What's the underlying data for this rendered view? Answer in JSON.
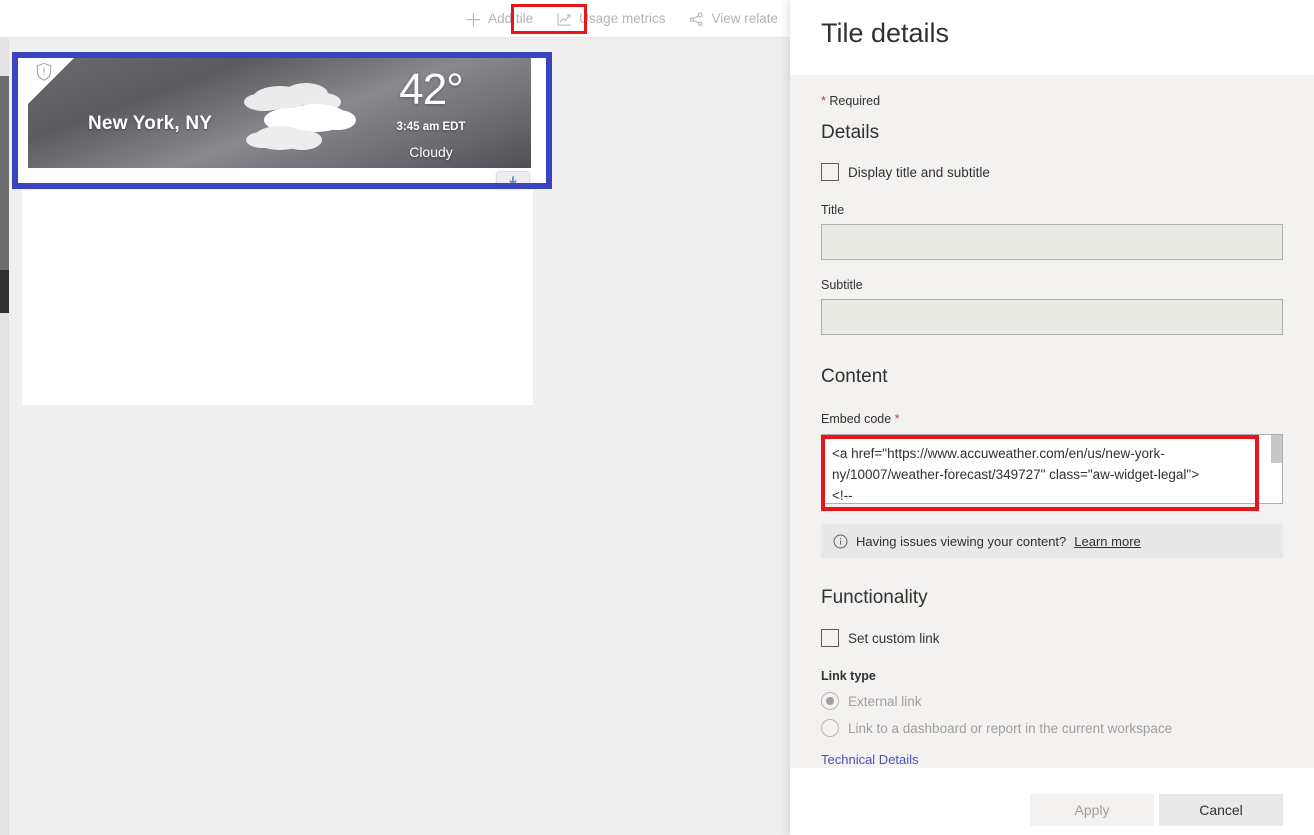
{
  "toolbar": {
    "items": [
      {
        "label": "Add tile",
        "icon": "plus-icon"
      },
      {
        "label": "Usage metrics",
        "icon": "usage-metrics-icon"
      },
      {
        "label": "View relate",
        "icon": "view-related-icon"
      }
    ]
  },
  "annotations": {
    "highlight_color": "#e8151a"
  },
  "tile": {
    "selection_color": "#3b44bd",
    "warning_icon": "shield-warning-icon",
    "download_icon": "download-icon",
    "weather": {
      "city": "New York, NY",
      "temperature": "42°",
      "time": "3:45 am EDT",
      "condition": "Cloudy",
      "art": "cloud-icon"
    }
  },
  "panel": {
    "title": "Tile details",
    "required_star": "*",
    "required_note": "Required",
    "details": {
      "heading": "Details",
      "display_checkbox_label": "Display title and subtitle",
      "display_checkbox_checked": false,
      "title_label": "Title",
      "title_value": "",
      "subtitle_label": "Subtitle",
      "subtitle_value": ""
    },
    "content": {
      "heading": "Content",
      "embed_label": "Embed code",
      "embed_required_star": "*",
      "embed_value": "<a href=\"https://www.accuweather.com/en/us/new-york-ny/10007/weather-forecast/349727\" class=\"aw-widget-legal\">\n<!--"
    },
    "info_bar": {
      "icon": "info-icon",
      "text": "Having issues viewing your content?",
      "link_text": "Learn more"
    },
    "functionality": {
      "heading": "Functionality",
      "custom_link_label": "Set custom link",
      "custom_link_checked": false,
      "link_type_label": "Link type",
      "options": [
        {
          "label": "External link",
          "selected": true,
          "disabled": true
        },
        {
          "label": "Link to a dashboard or report in the current workspace",
          "selected": false,
          "disabled": true
        }
      ],
      "technical_details_link": "Technical Details"
    },
    "footer": {
      "apply_label": "Apply",
      "cancel_label": "Cancel"
    }
  }
}
